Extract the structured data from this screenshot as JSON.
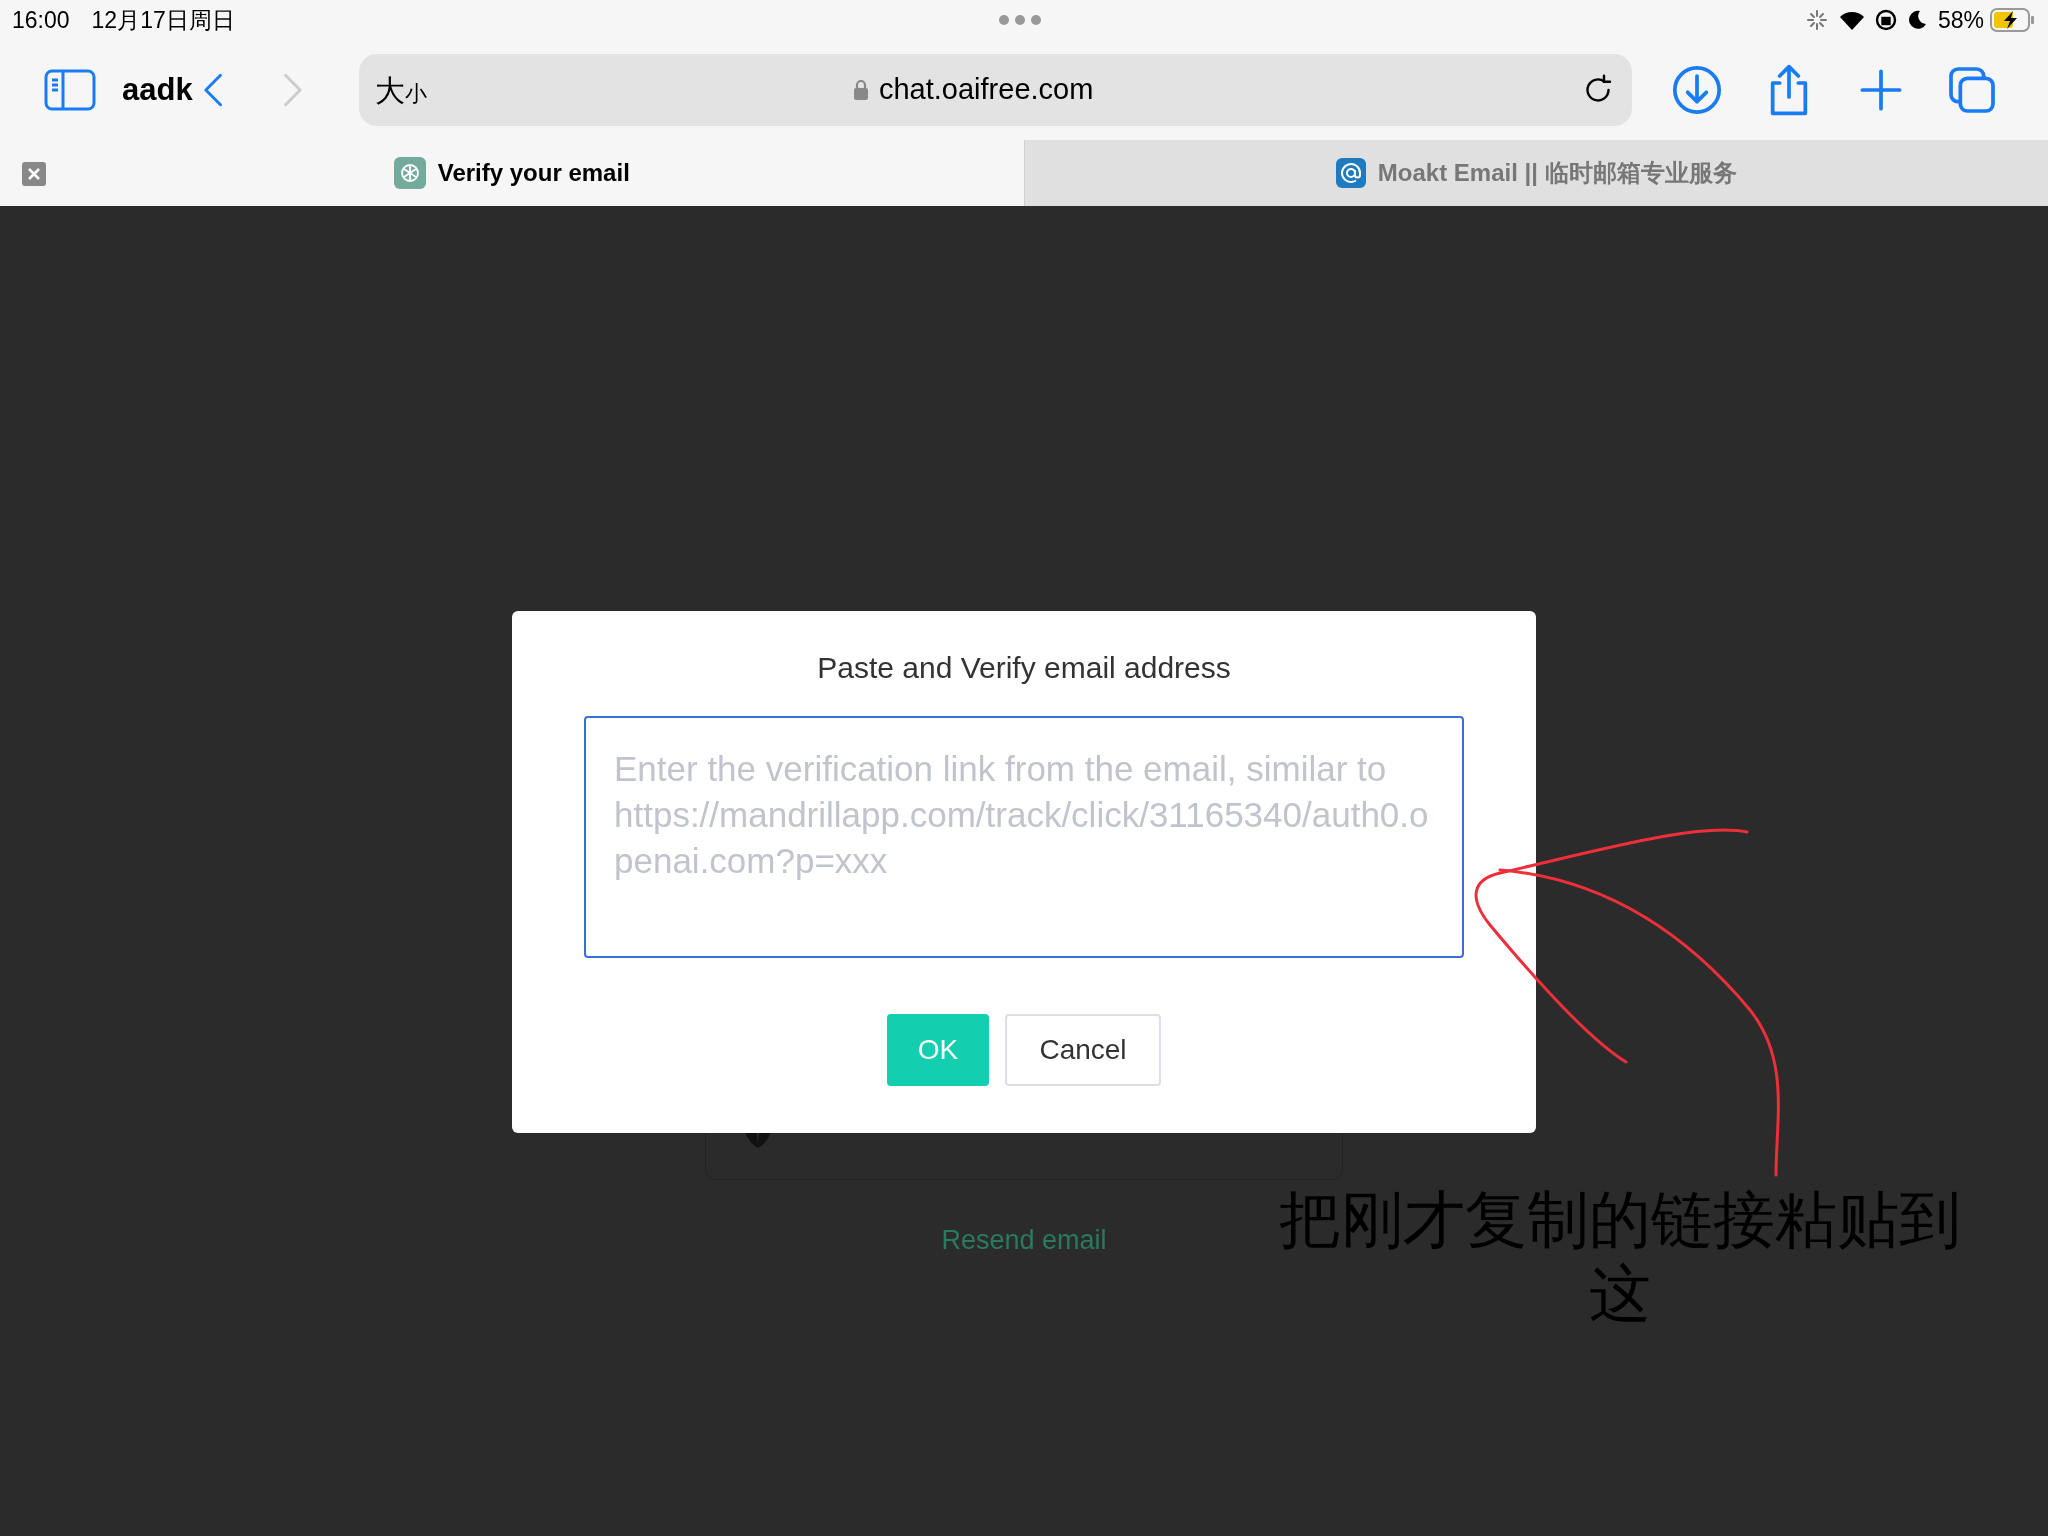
{
  "status_bar": {
    "time": "16:00",
    "date": "12月17日周日",
    "battery": "58%",
    "charging": true
  },
  "toolbar": {
    "profile": "aadk",
    "page_zoom": "大",
    "page_zoom_small": "小",
    "address": "chat.oaifree.com",
    "back_enabled": true,
    "forward_enabled": false
  },
  "tabs": [
    {
      "title": "Verify your email",
      "selected": true,
      "kind": "chat"
    },
    {
      "title": "Moakt Email || 临时邮箱专业服务",
      "selected": false,
      "kind": "mail"
    }
  ],
  "page": {
    "resend_link": "Resend email"
  },
  "dialog": {
    "title": "Paste and Verify email address",
    "placeholder": "Enter the verification link from the email, similar to https://mandrillapp.com/track/click/31165340/auth0.openai.com?p=xxx",
    "buttons": [
      {
        "label": "OK",
        "kind": "primary"
      },
      {
        "label": "Cancel",
        "kind": "secondary"
      }
    ]
  },
  "annotation": {
    "text": "把刚才复制的链接粘贴到这"
  }
}
